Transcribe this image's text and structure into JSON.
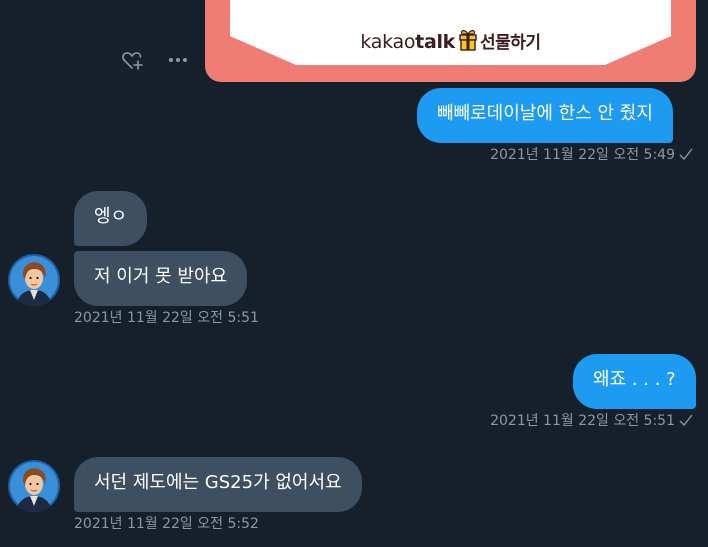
{
  "gift_card": {
    "brand_kakao": "kakao",
    "brand_talk": "talk",
    "label": "선물하기"
  },
  "messages": [
    {
      "text": "빼빼로데이날에 한스 안 줬지",
      "timestamp": "2021년 11월 22일 오전 5:49"
    },
    {
      "text": "엥ㅇ"
    },
    {
      "text": "저 이거 못 받아요",
      "timestamp": "2021년 11월 22일 오전 5:51"
    },
    {
      "text": "왜죠 . . . ?",
      "timestamp": "2021년 11월 22일 오전 5:51"
    },
    {
      "text": "서던 제도에는 GS25가 없어서요",
      "timestamp": "2021년 11월 22일 오전 5:52"
    }
  ],
  "icons": {
    "react": "heart-plus-icon",
    "more": "more-horizontal-icon",
    "seen": "checkmark-icon"
  },
  "colors": {
    "background": "#15202b",
    "sent_bubble": "#1d9bf0",
    "received_bubble": "#3d4f61",
    "timestamp": "#8b98a5",
    "gift_card": "#f07d74"
  }
}
